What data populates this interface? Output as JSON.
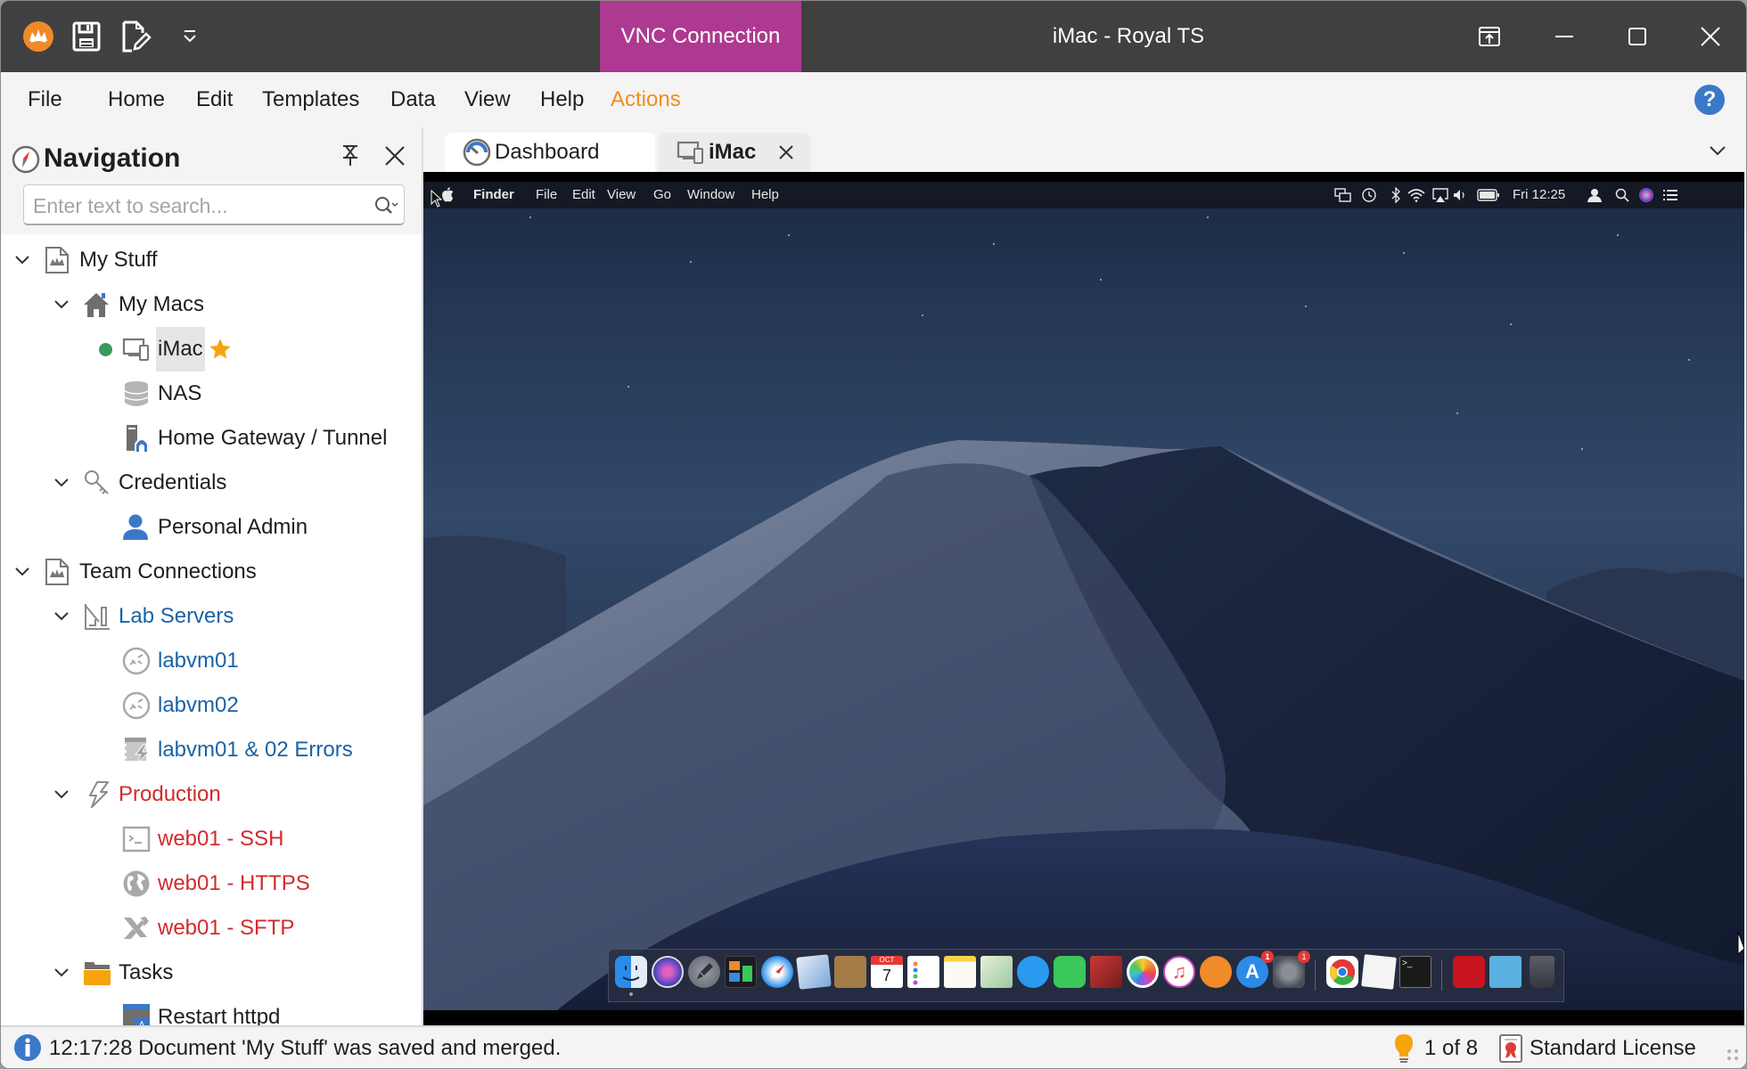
{
  "titlebar": {
    "context_tab": "VNC Connection",
    "window_title": "iMac - Royal TS",
    "context_tab_color": "#ae3990"
  },
  "quick_access": [
    {
      "icon": "royal-ts-logo-icon"
    },
    {
      "icon": "save-icon"
    },
    {
      "icon": "edit-document-icon"
    },
    {
      "icon": "customize-quick-access-icon"
    }
  ],
  "window_buttons": [
    "pop-out-icon",
    "minimize-icon",
    "maximize-icon",
    "close-icon"
  ],
  "menu": {
    "items": [
      "File",
      "Home",
      "Edit",
      "Templates",
      "Data",
      "View",
      "Help",
      "Actions"
    ],
    "accent_item": "Actions",
    "accent_color": "#f28c1c",
    "help_label": "?"
  },
  "navigation": {
    "title": "Navigation",
    "search_placeholder": "Enter text to search...",
    "search_value": "",
    "tree": [
      {
        "label": "My Stuff",
        "level": 0,
        "icon": "document-icon",
        "expanded": true,
        "color": "default"
      },
      {
        "label": "My Macs",
        "level": 1,
        "icon": "home-folder-icon",
        "expanded": true,
        "color": "default"
      },
      {
        "label": "iMac",
        "level": 2,
        "icon": "vnc-computer-icon",
        "status": "connected",
        "favorite": true,
        "selected": true,
        "color": "default"
      },
      {
        "label": "NAS",
        "level": 2,
        "icon": "database-icon",
        "color": "default"
      },
      {
        "label": "Home Gateway / Tunnel",
        "level": 2,
        "icon": "secure-gateway-icon",
        "color": "default"
      },
      {
        "label": "Credentials",
        "level": 1,
        "icon": "key-icon",
        "expanded": true,
        "color": "default"
      },
      {
        "label": "Personal Admin",
        "level": 2,
        "icon": "user-icon",
        "color": "default"
      },
      {
        "label": "Team Connections",
        "level": 0,
        "icon": "document-icon",
        "expanded": true,
        "color": "default"
      },
      {
        "label": "Lab Servers",
        "level": 1,
        "icon": "lab-folder-icon",
        "expanded": true,
        "color": "blue"
      },
      {
        "label": "labvm01",
        "level": 2,
        "icon": "remote-desktop-icon",
        "color": "blue"
      },
      {
        "label": "labvm02",
        "level": 2,
        "icon": "remote-desktop-icon",
        "color": "blue"
      },
      {
        "label": "labvm01 & 02 Errors",
        "level": 2,
        "icon": "event-log-icon",
        "color": "blue"
      },
      {
        "label": "Production",
        "level": 1,
        "icon": "lightning-folder-icon",
        "expanded": true,
        "color": "red"
      },
      {
        "label": "web01 - SSH",
        "level": 2,
        "icon": "terminal-icon",
        "color": "red"
      },
      {
        "label": "web01 - HTTPS",
        "level": 2,
        "icon": "globe-icon",
        "color": "red"
      },
      {
        "label": "web01 - SFTP",
        "level": 2,
        "icon": "file-transfer-icon",
        "color": "red"
      },
      {
        "label": "Tasks",
        "level": 1,
        "icon": "folder-icon",
        "expanded": true,
        "color": "default"
      },
      {
        "label": "Restart httpd",
        "level": 2,
        "icon": "task-icon",
        "color": "default"
      }
    ]
  },
  "tabs": [
    {
      "label": "Dashboard",
      "icon": "dashboard-icon",
      "active": false
    },
    {
      "label": "iMac",
      "icon": "vnc-computer-icon",
      "active": true,
      "closable": true
    }
  ],
  "remote": {
    "menubar": {
      "app_menu": [
        "Finder",
        "File",
        "Edit",
        "View",
        "Go",
        "Window",
        "Help"
      ],
      "clock": "Fri 12:25",
      "status_icons": [
        "mirroring-icon",
        "time-machine-icon",
        "bluetooth-icon",
        "wifi-icon",
        "airplay-icon",
        "volume-icon",
        "battery-icon",
        "user-icon",
        "spotlight-icon",
        "siri-icon",
        "notification-center-icon"
      ]
    },
    "dock": [
      {
        "name": "Finder",
        "running": true
      },
      {
        "name": "Siri"
      },
      {
        "name": "Launchpad"
      },
      {
        "name": "Mission Control"
      },
      {
        "name": "Safari"
      },
      {
        "name": "Mail"
      },
      {
        "name": "Contacts"
      },
      {
        "name": "Calendar",
        "month": "OCT",
        "day": "7"
      },
      {
        "name": "Reminders"
      },
      {
        "name": "Notes"
      },
      {
        "name": "Maps"
      },
      {
        "name": "Messages"
      },
      {
        "name": "FaceTime"
      },
      {
        "name": "Photo Booth"
      },
      {
        "name": "Photos"
      },
      {
        "name": "iTunes"
      },
      {
        "name": "iBooks"
      },
      {
        "name": "App Store",
        "badge": "1"
      },
      {
        "name": "System Preferences",
        "badge": "1"
      },
      {
        "name": "Google Chrome"
      },
      {
        "name": "TextEdit"
      },
      {
        "name": "Terminal"
      },
      {
        "name": "Acrobat Reader"
      },
      {
        "name": "Downloads"
      },
      {
        "name": "Trash"
      }
    ]
  },
  "status": {
    "message": "12:17:28 Document 'My Stuff' was saved and merged.",
    "hints": "1 of 8",
    "license": "Standard License"
  }
}
